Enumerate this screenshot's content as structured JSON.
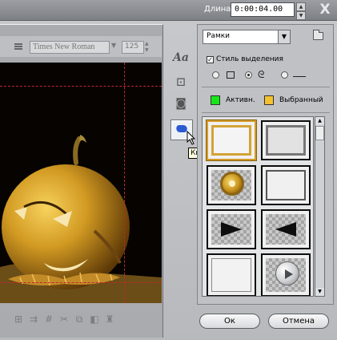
{
  "header": {
    "duration_label": "Длина:",
    "duration_value": "0:00:04.00",
    "close_glyph": "X"
  },
  "editor": {
    "font_name": "Times New Roman",
    "font_size": "125",
    "bottom_tools": [
      "align-icon",
      "distribute-icon",
      "grid-icon",
      "cut-icon",
      "copy-icon",
      "paste-icon",
      "delete-icon"
    ]
  },
  "side_tools": {
    "text_glyph": "Aa",
    "shape_glyph": "⊡",
    "picture_glyph": "◙",
    "tooltip": "Кнопки"
  },
  "buttons_panel": {
    "category": "Рамки",
    "style_label": "Стиль выделения",
    "style_checked": true,
    "shape_options": [
      "rectangle",
      "lasso",
      "line"
    ],
    "shape_selected": "lasso",
    "active_label": "Активн.",
    "active_color": "#16e716",
    "selected_label": "Выбранный",
    "selected_color": "#f4c22d"
  },
  "gallery": {
    "items": [
      "frame-gold",
      "frame-screen",
      "gold-ring",
      "frame-white",
      "play-right",
      "play-left",
      "plain-square",
      "round-play"
    ]
  },
  "footer": {
    "ok_label": "Ок",
    "cancel_label": "Отмена"
  }
}
